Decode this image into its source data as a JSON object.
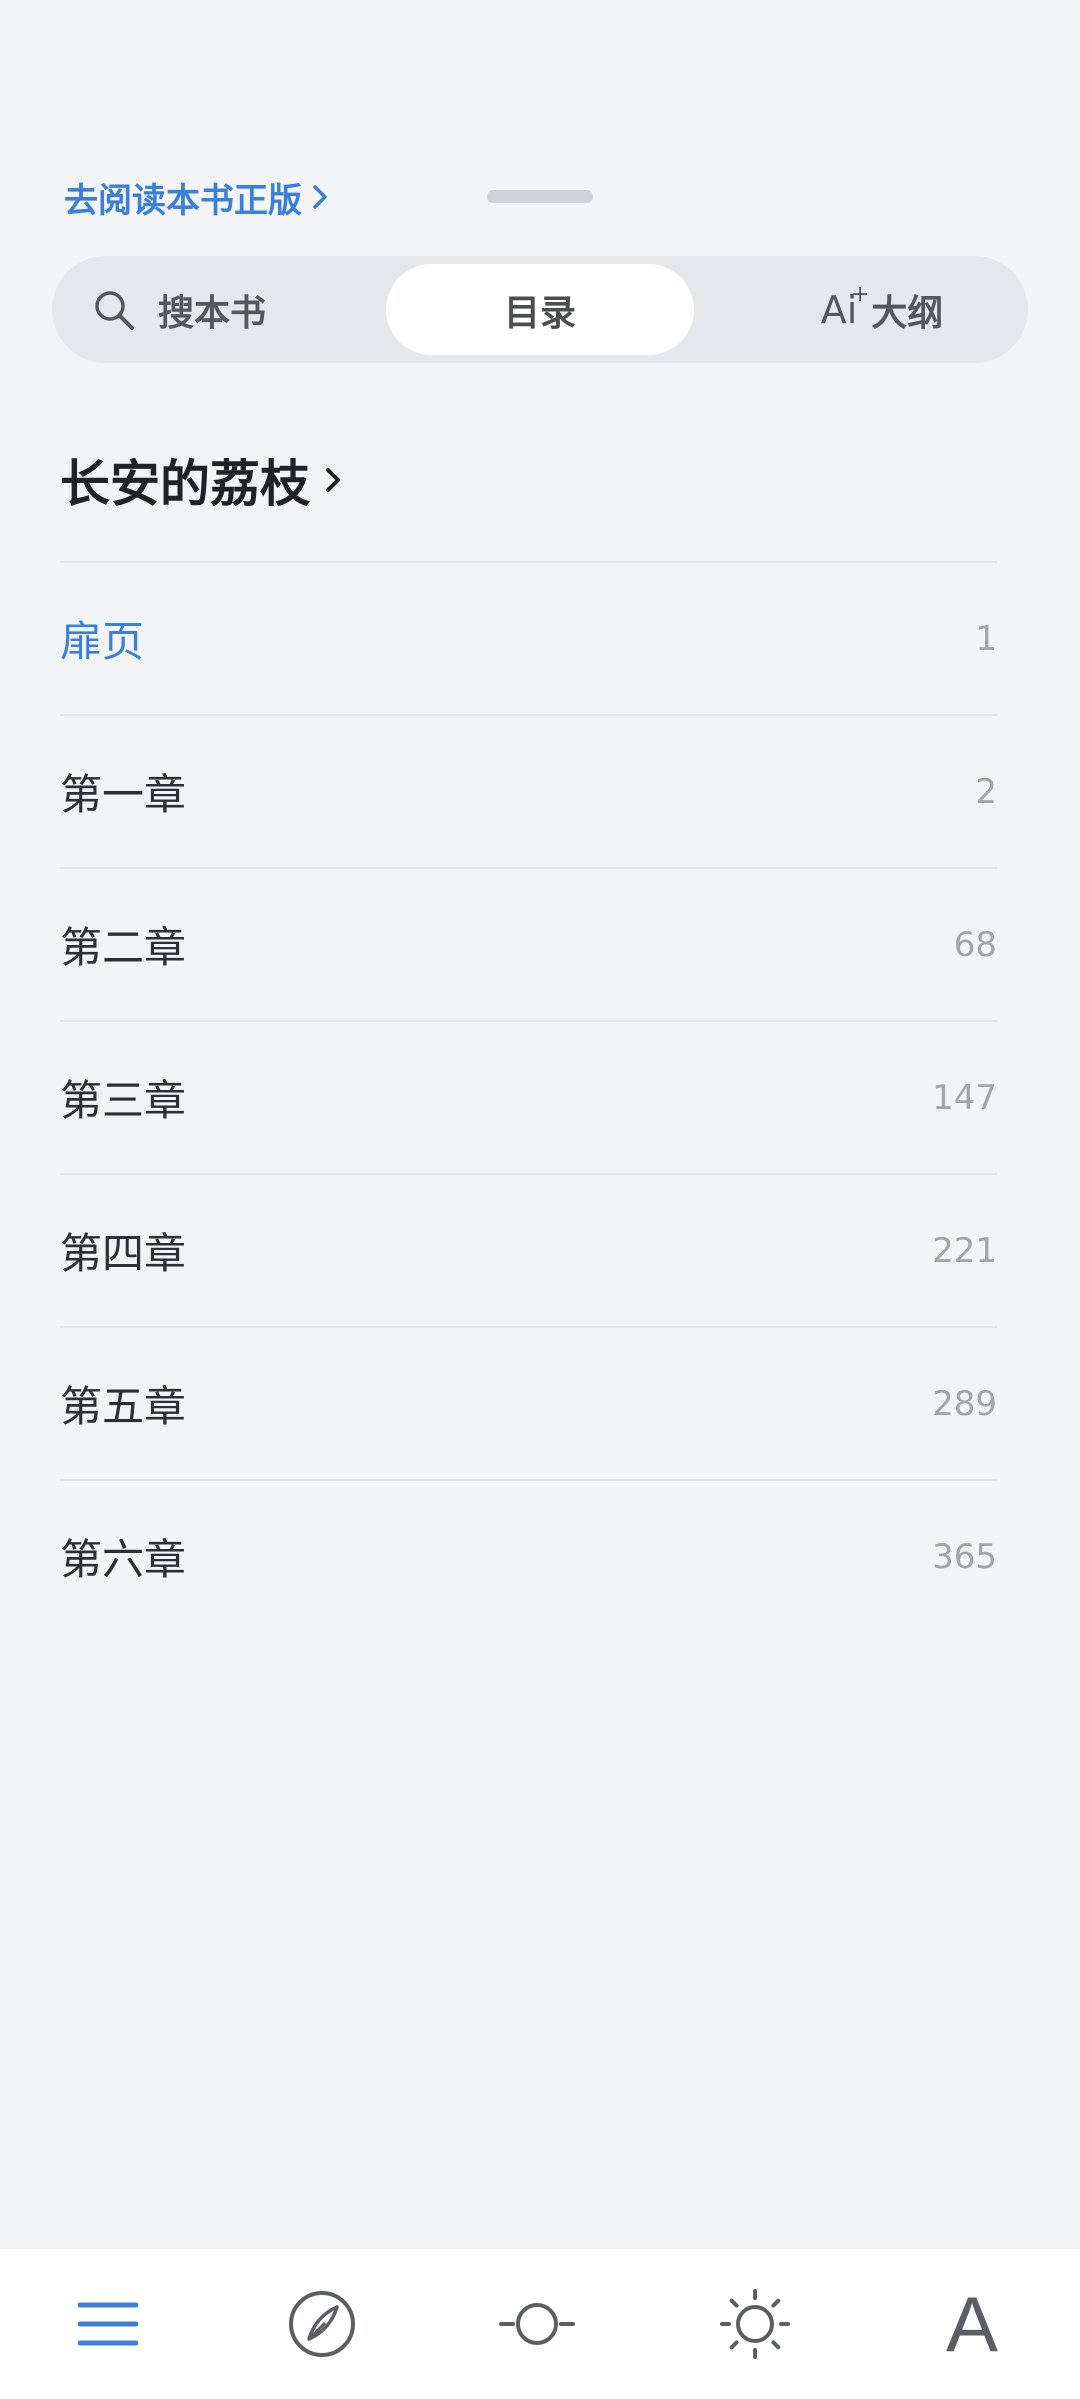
{
  "header": {
    "buy_link": "去阅读本书正版"
  },
  "tabs": {
    "search": "搜本书",
    "toc": "目录",
    "outline_icon_text": "Ai",
    "outline": "大纲"
  },
  "book": {
    "title": "长安的荔枝"
  },
  "chapters": [
    {
      "title": "扉页",
      "page": "1"
    },
    {
      "title": "第一章",
      "page": "2"
    },
    {
      "title": "第二章",
      "page": "68"
    },
    {
      "title": "第三章",
      "page": "147"
    },
    {
      "title": "第四章",
      "page": "221"
    },
    {
      "title": "第五章",
      "page": "289"
    },
    {
      "title": "第六章",
      "page": "365"
    }
  ],
  "toolbar": {
    "items": [
      "menu-icon",
      "compass-icon",
      "progress-slider-icon",
      "brightness-icon",
      "font-icon"
    ],
    "font_label": "A"
  },
  "colors": {
    "accent": "#3b7fd6",
    "background": "#f3f4f6",
    "icon": "#5b5e63"
  }
}
